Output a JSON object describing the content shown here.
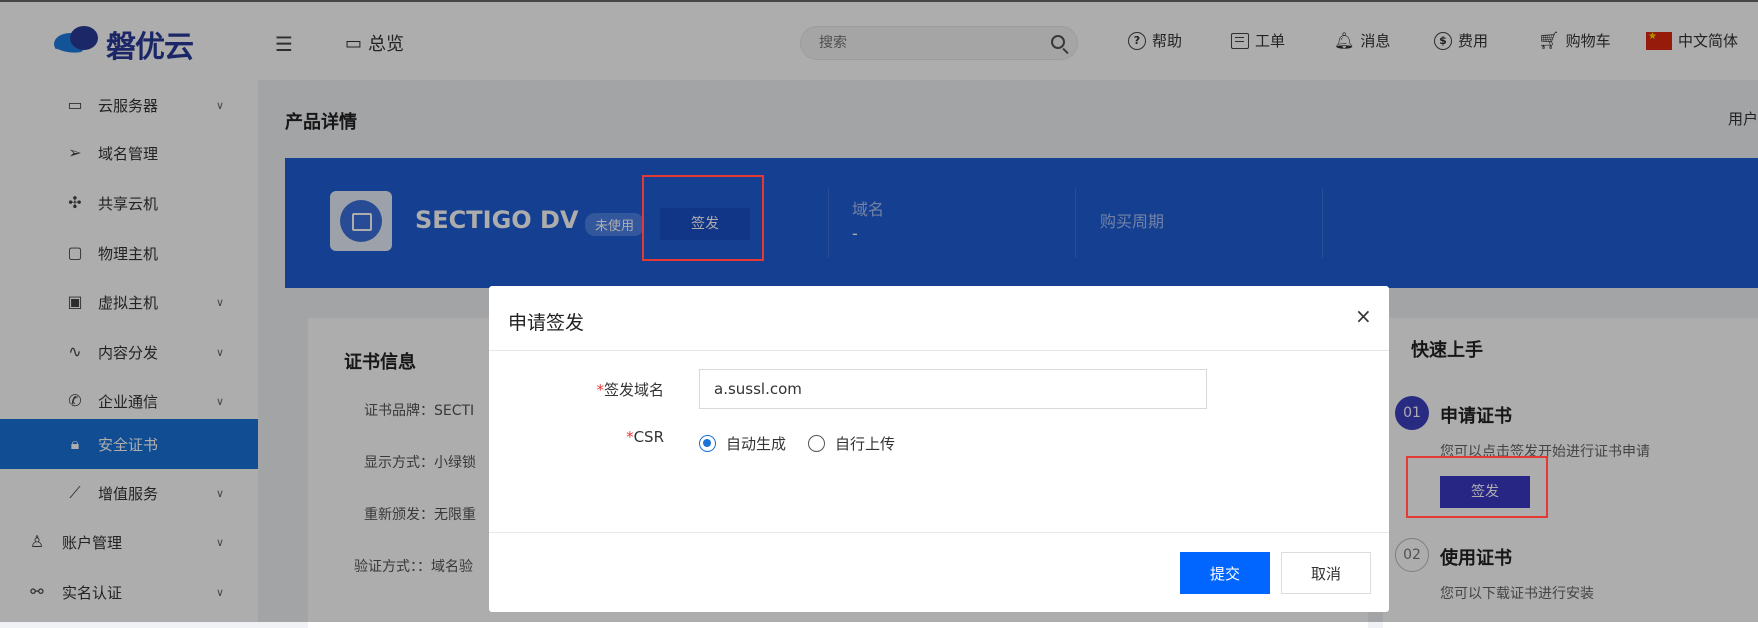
{
  "header": {
    "logo_text": "磐优云",
    "overview_label": "总览",
    "search_placeholder": "搜索",
    "nav": {
      "help": "帮助",
      "ticket": "工单",
      "messages": "消息",
      "billing": "费用",
      "cart": "购物车",
      "language": "中文简体"
    }
  },
  "sidebar": {
    "items": [
      {
        "label": "云服务器",
        "icon": "monitor-icon"
      },
      {
        "label": "域名管理",
        "icon": "send-icon"
      },
      {
        "label": "共享云机",
        "icon": "puzzle-icon"
      },
      {
        "label": "物理主机",
        "icon": "laptop-icon"
      },
      {
        "label": "虚拟主机",
        "icon": "image-icon"
      },
      {
        "label": "内容分发",
        "icon": "wave-icon"
      },
      {
        "label": "企业通信",
        "icon": "phone-icon"
      },
      {
        "label": "安全证书",
        "icon": "lock-icon"
      },
      {
        "label": "增值服务",
        "icon": "chart-icon"
      },
      {
        "label": "账户管理",
        "icon": "user-icon"
      },
      {
        "label": "实名认证",
        "icon": "nodes-icon"
      }
    ]
  },
  "main": {
    "page_title": "产品详情",
    "user_link": "用户",
    "product": {
      "name": "SECTIGO DV",
      "status_badge": "未使用",
      "issue_button": "签发",
      "domain_label": "域名",
      "domain_value": "-",
      "period_label": "购买周期"
    },
    "cert_info": {
      "title": "证书信息",
      "rows": [
        "证书品牌：SECTI",
        "显示方式：小绿锁",
        "重新颁发：无限重",
        "验证方式：：域名验"
      ]
    },
    "quick_start": {
      "title": "快速上手",
      "step1_num": "01",
      "step1_title": "申请证书",
      "step1_desc": "您可以点击签发开始进行证书申请",
      "step1_button": "签发",
      "step2_num": "02",
      "step2_title": "使用证书",
      "step2_desc": "您可以下载证书进行安装"
    }
  },
  "modal": {
    "title": "申请签发",
    "close": "×",
    "domain_label": "签发域名",
    "domain_value": "a.sussl.com",
    "csr_label": "CSR",
    "csr_options": [
      "自动生成",
      "自行上传"
    ],
    "csr_selected": "自动生成",
    "submit": "提交",
    "cancel": "取消"
  },
  "colors": {
    "primary": "#0066ff",
    "banner": "#1f5dd6",
    "active_menu": "#1a72d8",
    "highlight": "#e53935"
  }
}
